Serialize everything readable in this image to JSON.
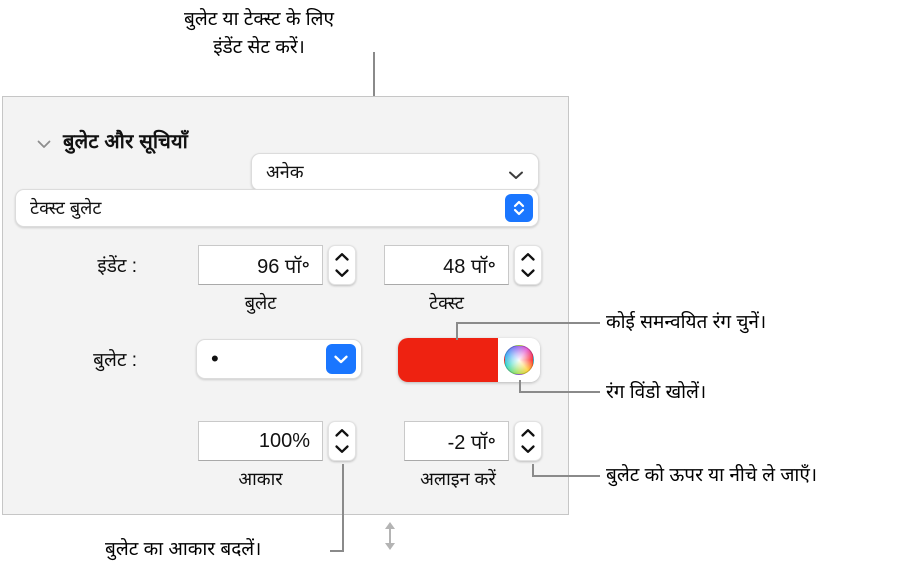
{
  "annotations": {
    "top": {
      "line1": "बुलेट या टेक्स्ट के लिए",
      "line2": "इंडेंट सेट करें।"
    },
    "coordinated_color": "कोई समन्वयित रंग चुनें।",
    "open_color_window": "रंग विंडो खोलें।",
    "move_bullet": "बुलेट को ऊपर या नीचे ले जाएँ।",
    "change_bullet_size": "बुलेट का आकार बदलें।"
  },
  "panel": {
    "section_title": "बुलेट और सूचियाँ",
    "disclosure_icon": "chevron-down-icon",
    "list_style": {
      "value": "अनेक",
      "icon": "chevron-down-icon"
    },
    "bullet_type": {
      "value": "टेक्स्ट बुलेट",
      "icon": "up-down-chevron-icon"
    },
    "indent": {
      "label": "इंडेंट :",
      "bullet": {
        "value": "96 पॉ॰",
        "caption": "बुलेट",
        "stepper_icon": "up-down-stepper-icon"
      },
      "text": {
        "value": "48 पॉ॰",
        "caption": "टेक्स्ट",
        "stepper_icon": "up-down-stepper-icon"
      }
    },
    "bullet": {
      "label": "बुलेट :",
      "glyph": "•",
      "popup_icon": "chevron-down-icon",
      "color": "#ee2211",
      "color_wheel_icon": "color-wheel-icon"
    },
    "size": {
      "value": "100%",
      "caption": "आकार",
      "stepper_icon": "up-down-stepper-icon"
    },
    "align": {
      "value": "-2 पॉ॰",
      "caption": "अलाइन करें",
      "icon": "vertical-double-arrow-icon",
      "stepper_icon": "up-down-stepper-icon"
    }
  },
  "colors": {
    "panel_background": "#f3f3f3",
    "panel_border": "#c6c6c6",
    "accent_blue": "#1a76ff",
    "leader_line": "#8a8a8a",
    "bullet_color": "#ee2211"
  }
}
